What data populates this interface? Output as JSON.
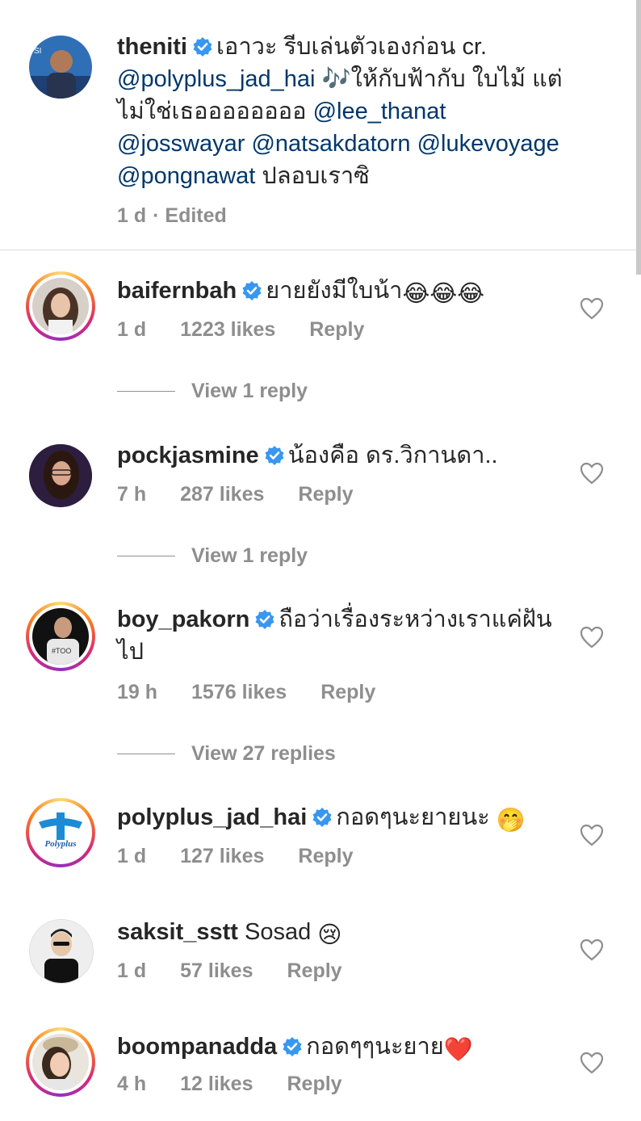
{
  "caption": {
    "username": "theniti",
    "text_1": "เอาวะ รีบเล่นตัวเองก่อน cr.",
    "mention_1": "@polyplus_jad_hai",
    "note_emoji": "🎶",
    "text_2": "ให้กับฟ้ากับ ใบไม้ แต่ ไม่ใช่เธออออออออ",
    "mention_2": "@lee_thanat",
    "mention_3": "@josswayar",
    "mention_4": "@natsakdatorn",
    "mention_5": "@lukevoyage",
    "mention_6": "@pongnawat",
    "text_3": "ปลอบเราซิ",
    "time": "1 d",
    "edited": "· Edited"
  },
  "comments": [
    {
      "username": "baifernbah",
      "text": "ยายยังมีใบน้า",
      "emoji": "😂😂😂",
      "time": "1 d",
      "likes": "1223 likes",
      "reply": "Reply",
      "view_replies": "View 1 reply"
    },
    {
      "username": "pockjasmine",
      "text": "น้องคือ ดร.วิกานดา..",
      "time": "7 h",
      "likes": "287 likes",
      "reply": "Reply",
      "view_replies": "View 1 reply"
    },
    {
      "username": "boy_pakorn",
      "text": "ถือว่าเรื่องระหว่างเราแค่ฝันไป",
      "time": "19 h",
      "likes": "1576 likes",
      "reply": "Reply",
      "view_replies": "View 27 replies"
    },
    {
      "username": "polyplus_jad_hai",
      "text": "กอดๆนะยายนะ",
      "emoji": "🤭",
      "time": "1 d",
      "likes": "127 likes",
      "reply": "Reply",
      "avatar_text": "Polyplus"
    },
    {
      "username": "saksit_sstt",
      "text": "Sosad",
      "emoji": "😢",
      "time": "1 d",
      "likes": "57 likes",
      "reply": "Reply"
    },
    {
      "username": "boompanadda",
      "text": "กอดๆๆนะยาย",
      "emoji": "❤️",
      "time": "4 h",
      "likes": "12 likes",
      "reply": "Reply"
    }
  ],
  "icons": {
    "verified": "verified-badge-icon",
    "like": "heart-icon"
  },
  "colors": {
    "link": "#00376b",
    "verified": "#3897f0",
    "muted": "#8e8e8e"
  }
}
